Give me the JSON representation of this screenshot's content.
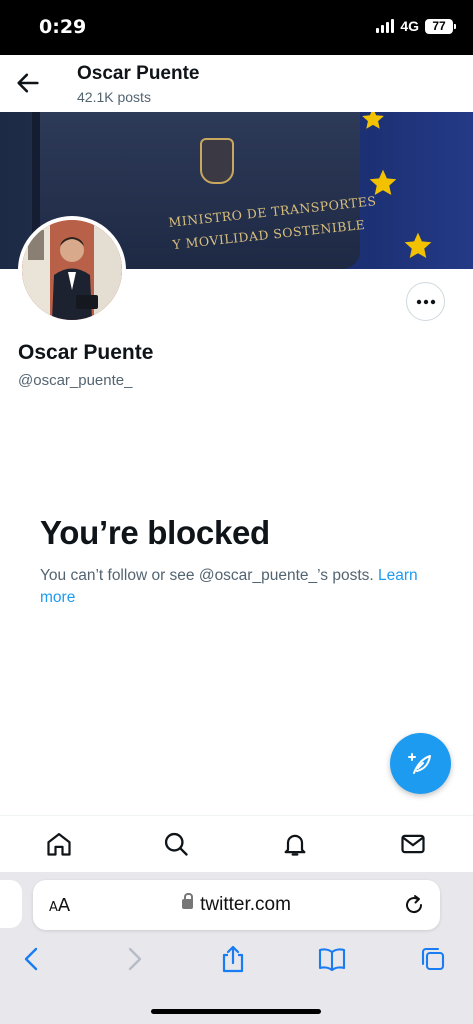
{
  "status_bar": {
    "time": "0:29",
    "network": "4G",
    "battery": "77"
  },
  "header": {
    "title": "Oscar Puente",
    "posts": "42.1K posts"
  },
  "banner": {
    "line1": "MINISTRO DE TRANSPORTES",
    "line2": "Y MOVILIDAD SOSTENIBLE"
  },
  "profile": {
    "name": "Oscar Puente",
    "handle": "@oscar_puente_"
  },
  "blocked": {
    "title": "You’re blocked",
    "message": "You can’t follow or see @oscar_puente_’s posts.",
    "link": "Learn more"
  },
  "browser": {
    "aa_small": "A",
    "aa_large": "A",
    "url": "twitter.com"
  },
  "icons": {
    "back": "arrow-left-icon",
    "more": "more-horizontal-icon",
    "compose": "feather-plus-icon",
    "home": "home-icon",
    "search": "search-icon",
    "notifications": "bell-icon",
    "messages": "mail-icon",
    "reload": "reload-icon",
    "browser_back": "chevron-left-icon",
    "browser_forward": "chevron-right-icon",
    "share": "share-icon",
    "bookmarks": "book-icon",
    "tabs": "tabs-icon"
  },
  "colors": {
    "accent": "#1d9bf0",
    "text": "#0f1419",
    "muted": "#536471"
  }
}
